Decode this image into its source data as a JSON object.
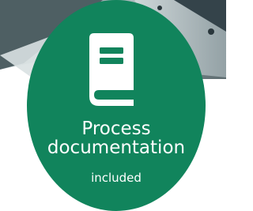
{
  "badge": {
    "icon": "book-icon",
    "title_line1": "Process",
    "title_line2": "documentation",
    "subtitle": "included",
    "color": "#11845c"
  }
}
